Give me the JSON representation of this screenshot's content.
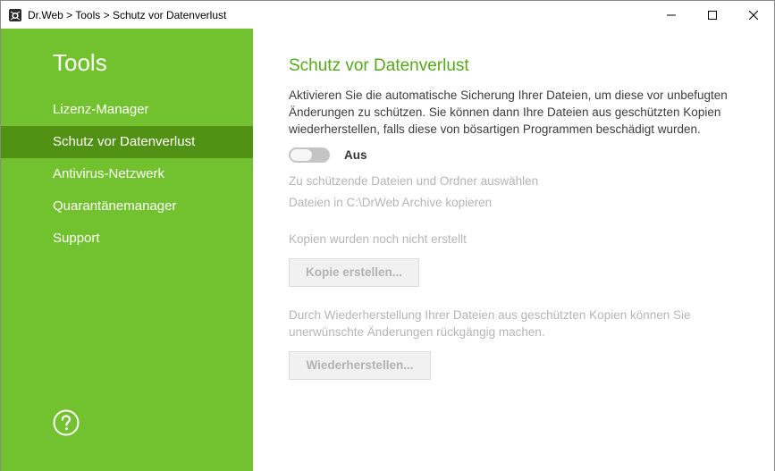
{
  "window": {
    "title": "Dr.Web > Tools > Schutz vor Datenverlust",
    "app_icon": "drweb-spider-icon",
    "controls": [
      "minimize-icon",
      "maximize-icon",
      "close-icon"
    ]
  },
  "colors": {
    "sidebar_bg": "#72c12e",
    "sidebar_active": "#519114",
    "heading": "#56a81a",
    "disabled_text": "#b5b5b5"
  },
  "sidebar": {
    "title": "Tools",
    "items": [
      {
        "label": "Lizenz-Manager",
        "active": false
      },
      {
        "label": "Schutz vor Datenverlust",
        "active": true
      },
      {
        "label": "Antivirus-Netzwerk",
        "active": false
      },
      {
        "label": "Quarantänemanager",
        "active": false
      },
      {
        "label": "Support",
        "active": false
      }
    ],
    "help_icon": "question-circle-icon"
  },
  "main": {
    "heading": "Schutz vor Datenverlust",
    "description": "Aktivieren Sie die automatische Sicherung Ihrer Dateien, um diese vor unbefugten Änderungen zu schützen. Sie können dann Ihre Dateien aus geschützten Kopien wiederherstellen, falls diese von bösartigen Programmen beschädigt wurden.",
    "toggle": {
      "state": "off",
      "label": "Aus"
    },
    "select_link": "Zu schützende Dateien und Ordner auswählen",
    "copy_link": "Dateien in C:\\DrWeb Archive kopieren",
    "status": "Kopien wurden noch nicht erstellt",
    "create_copy_button": "Kopie erstellen...",
    "restore_description": "Durch Wiederherstellung Ihrer Dateien aus geschützten Kopien können Sie unerwünschte Änderungen rückgängig machen.",
    "restore_button": "Wiederherstellen..."
  }
}
